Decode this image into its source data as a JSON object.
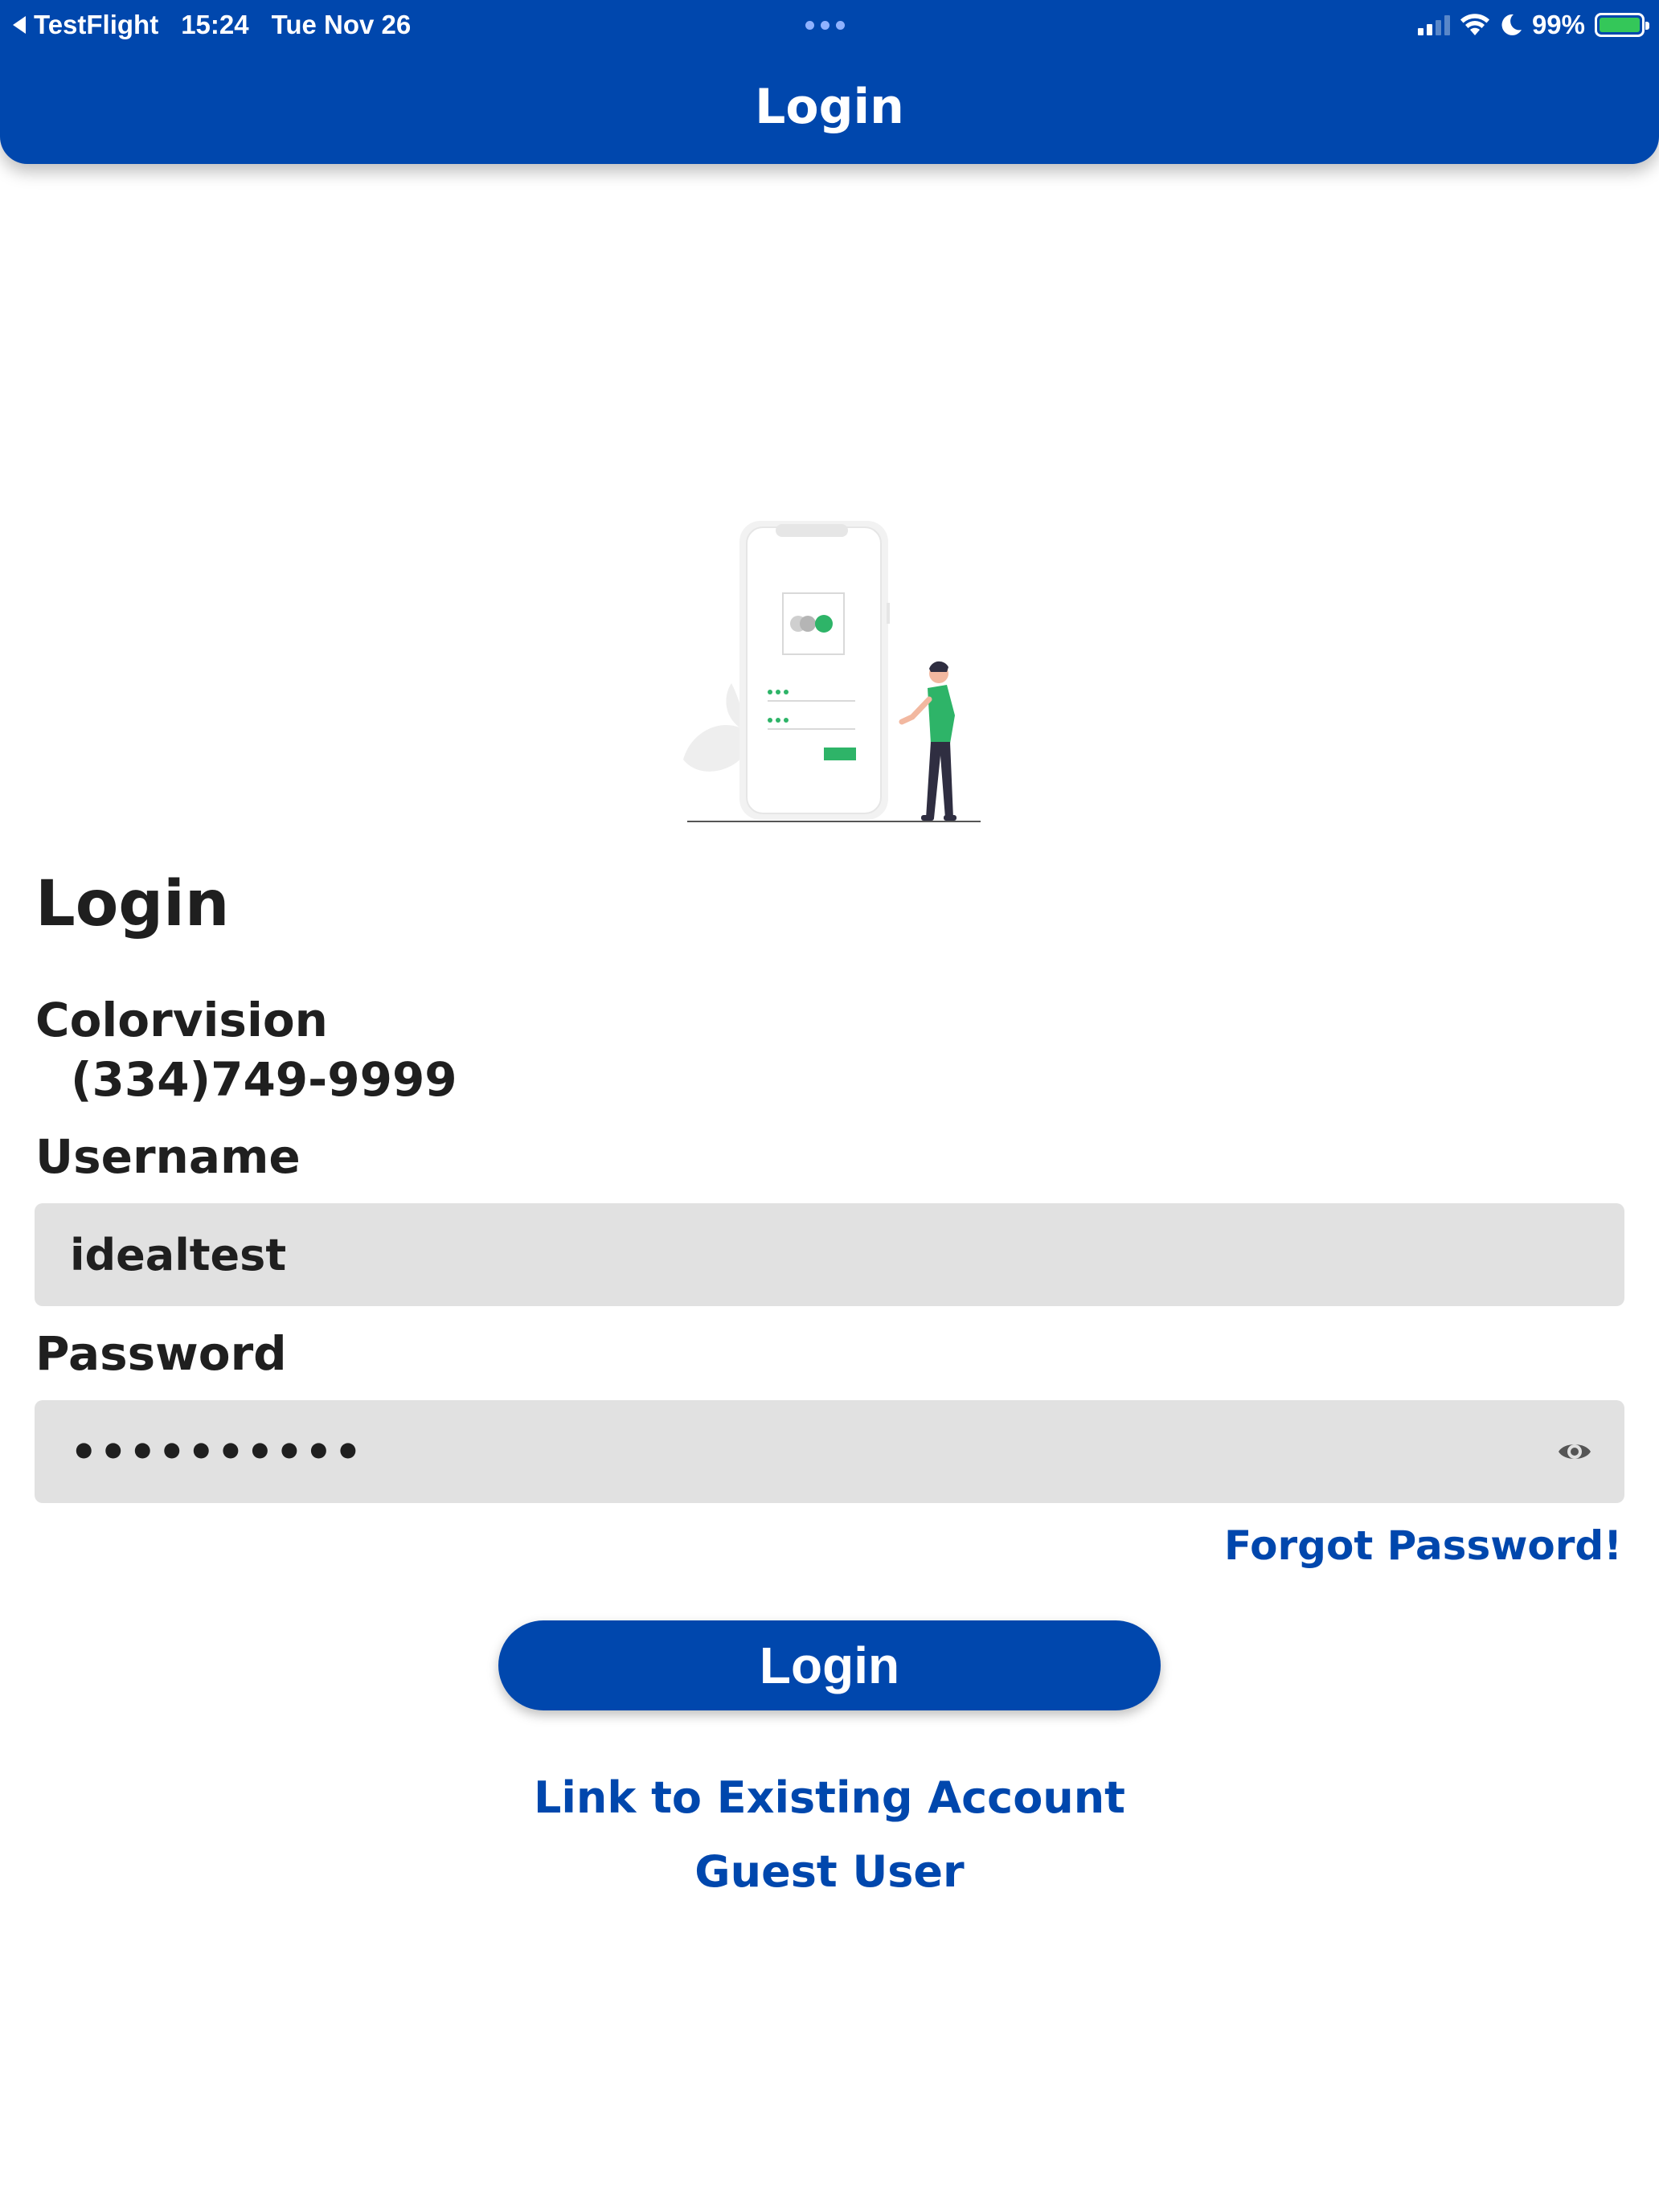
{
  "status_bar": {
    "back_app": "TestFlight",
    "time": "15:24",
    "date": "Tue Nov 26",
    "battery": "99%"
  },
  "header": {
    "title": "Login"
  },
  "content": {
    "heading": "Login",
    "company_name": "Colorvision",
    "company_phone": "(334)749-9999",
    "username_label": "Username",
    "username_value": "idealtest",
    "password_label": "Password",
    "password_masked": "••••••••••",
    "forgot_password": "Forgot Password!",
    "login_button": "Login",
    "link_account": "Link to Existing Account",
    "guest_user": "Guest User"
  },
  "colors": {
    "brand_blue": "#0047ad",
    "field_bg": "#e1e1e1",
    "illustration_green": "#2eb468"
  },
  "icons": [
    "back-triangle-icon",
    "cellular-signal-icon",
    "wifi-icon",
    "moon-icon",
    "battery-icon",
    "eye-icon"
  ]
}
